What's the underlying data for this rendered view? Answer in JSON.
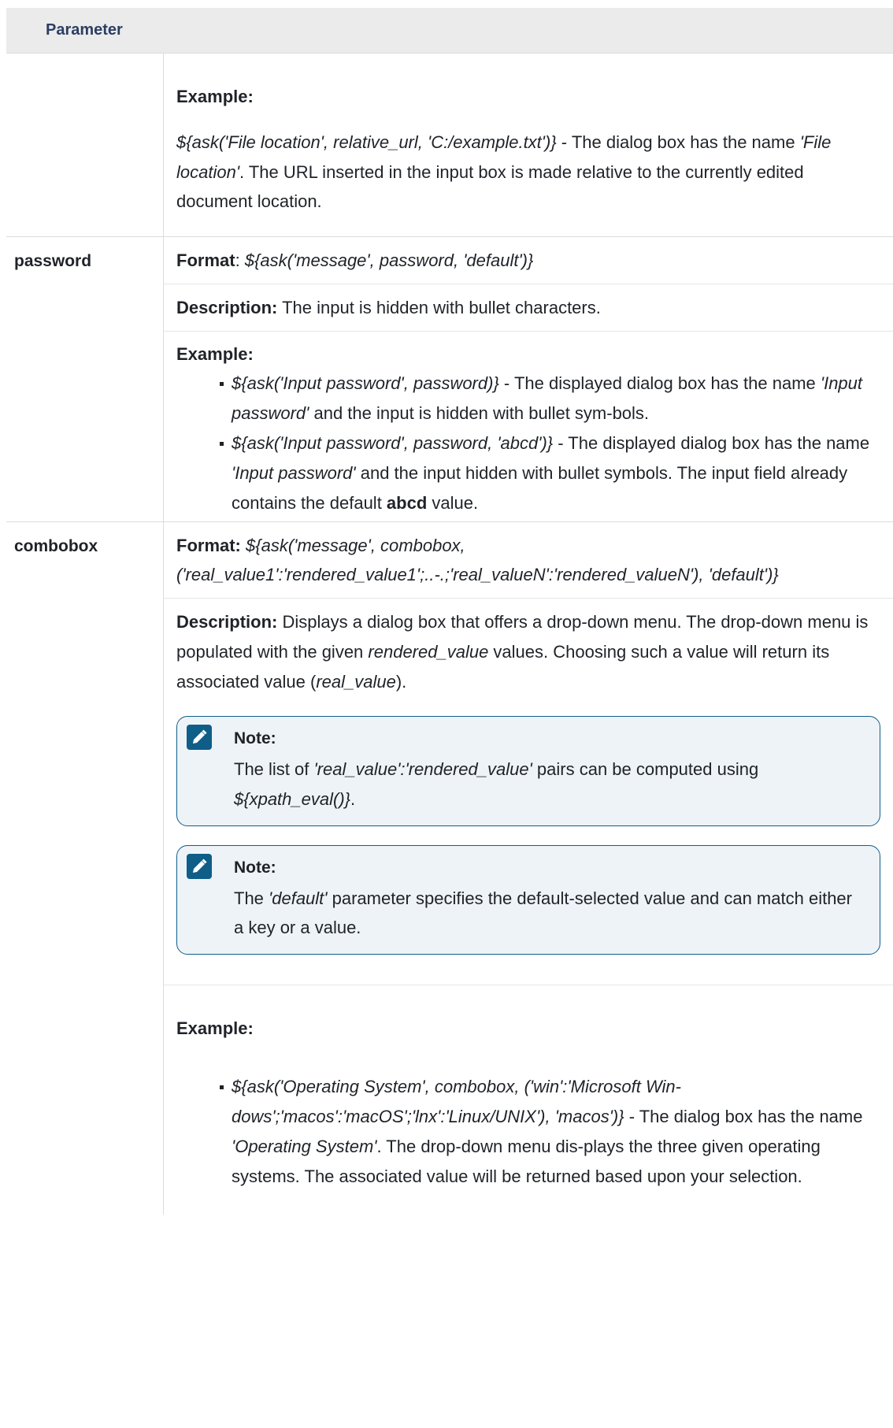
{
  "header": {
    "parameter": "Parameter"
  },
  "row0": {
    "example_label": "Example:",
    "example_code": "${ask('File location', relative_url, 'C:/example.txt')}",
    "example_t1": " - The dialog box has the name ",
    "example_name": "'File location'",
    "example_t2": ". The URL inserted in the input box is made relative to the currently edited document location."
  },
  "password": {
    "name": "password",
    "format_label": "Format",
    "format_sep": ": ",
    "format_code": "${ask('message', password, 'default')}",
    "desc_label": "Description:",
    "desc_text": " The input is hidden with bullet characters.",
    "example_label": "Example:",
    "ex1_code": "${ask('Input password', password)}",
    "ex1_t1": " - The displayed dialog box has the name ",
    "ex1_name": "'Input password'",
    "ex1_t2": " and the input is hidden with bullet sym-bols.",
    "ex2_code": "${ask('Input password', password, 'abcd')}",
    "ex2_t1": " - The displayed dialog box has the name ",
    "ex2_name": "'Input password'",
    "ex2_t2": " and the input hidden with bullet symbols. The input field already contains the default ",
    "ex2_bold": "abcd",
    "ex2_t3": " value."
  },
  "combobox": {
    "name": "combobox",
    "format_label": "Format:",
    "format_code": "${ask('message', combobox, ('real_value1':'rendered_value1';..-.;'real_valueN':'rendered_valueN'), 'default')}",
    "desc_label": "Description:",
    "desc_t1": " Displays a dialog box that offers a drop-down menu. The drop-down menu is populated with the given ",
    "desc_i1": "rendered_value",
    "desc_t2": " values. Choosing such a value will return its associated value (",
    "desc_i2": "real_value",
    "desc_t3": ").",
    "note1_title": "Note:",
    "note1_t1": "The list of ",
    "note1_i1": "'real_value':'rendered_value'",
    "note1_t2": " pairs can be computed using ",
    "note1_i2": "${xpath_eval()}",
    "note1_t3": ".",
    "note2_title": "Note:",
    "note2_t1": "The ",
    "note2_i1": "'default'",
    "note2_t2": " parameter specifies the default-selected value and can match either a key or a value.",
    "example_label": "Example:",
    "ex_code": "${ask('Operating System', combobox, ('win':'Microsoft Win-dows';'macos':'macOS';'lnx':'Linux/UNIX'), 'macos')}",
    "ex_t1": " - The dialog box has the name ",
    "ex_name": "'Operating System'",
    "ex_t2": ". The drop-down menu dis-plays the three given operating systems. The associated value will be returned based upon your selection."
  },
  "icons": {
    "note": "pencil-note-icon"
  },
  "colors": {
    "header_bg": "#ebebeb",
    "header_text": "#2b3e63",
    "note_border": "#0f5f8a",
    "note_bg": "#eef3f8",
    "note_icon": "#0e5e88"
  }
}
